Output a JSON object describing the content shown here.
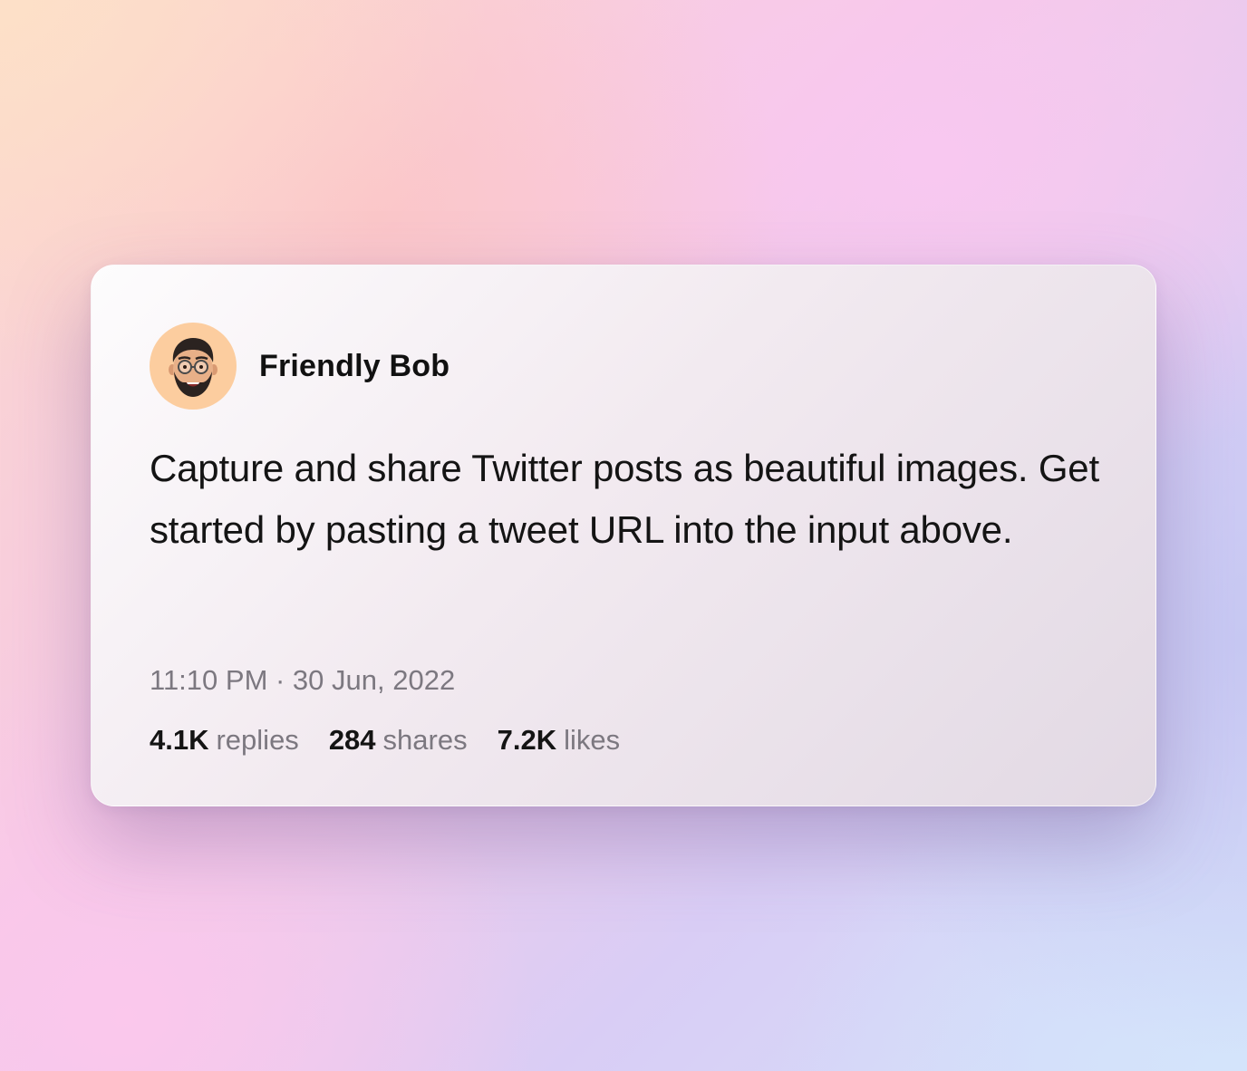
{
  "tweet": {
    "author": "Friendly Bob",
    "text": "Capture and share Twitter posts as beautiful images. Get started by pasting a tweet URL into the input above.",
    "timestamp": "11:10 PM · 30 Jun, 2022",
    "avatar_icon": "memoji-avatar-icon",
    "avatar_bg": "#fccd9f",
    "stats": {
      "replies_count": "4.1K",
      "replies_label": "replies",
      "shares_count": "284",
      "shares_label": "shares",
      "likes_count": "7.2K",
      "likes_label": "likes"
    }
  }
}
